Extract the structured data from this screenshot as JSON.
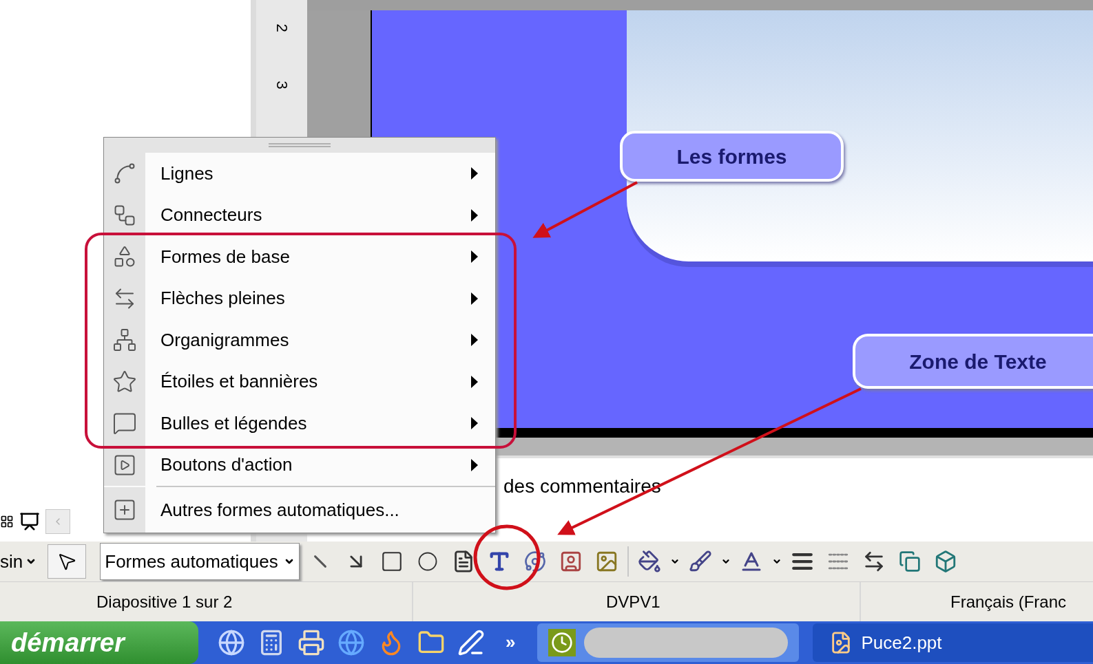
{
  "ruler": {
    "marks": [
      "2",
      "3"
    ]
  },
  "slide": {
    "callouts": [
      {
        "text": "Les formes"
      },
      {
        "text": "Zone de Texte"
      }
    ]
  },
  "notes": {
    "text": "des commentaires"
  },
  "menu": {
    "items": [
      {
        "label": "Lignes",
        "kind": "submenu"
      },
      {
        "label": "Connecteurs",
        "kind": "submenu"
      },
      {
        "label": "Formes de base",
        "kind": "submenu"
      },
      {
        "label": "Flèches pleines",
        "kind": "submenu"
      },
      {
        "label": "Organigrammes",
        "kind": "submenu"
      },
      {
        "label": "Étoiles et bannières",
        "kind": "submenu"
      },
      {
        "label": "Bulles et légendes",
        "kind": "submenu"
      },
      {
        "label": "Boutons d'action",
        "kind": "submenu"
      },
      {
        "label": "Autres formes automatiques...",
        "kind": "command"
      }
    ]
  },
  "drawing_toolbar": {
    "draw_menu": "sin",
    "autoshapes": {
      "label": "Formes automatiques",
      "open": true
    }
  },
  "status_bar": [
    "Diapositive 1 sur 2",
    "DVPV1",
    "Français (Franc"
  ],
  "taskbar": {
    "start": "démarrer",
    "overflow": "»",
    "tasks": [
      {
        "label": "Puce2.ppt"
      }
    ]
  }
}
